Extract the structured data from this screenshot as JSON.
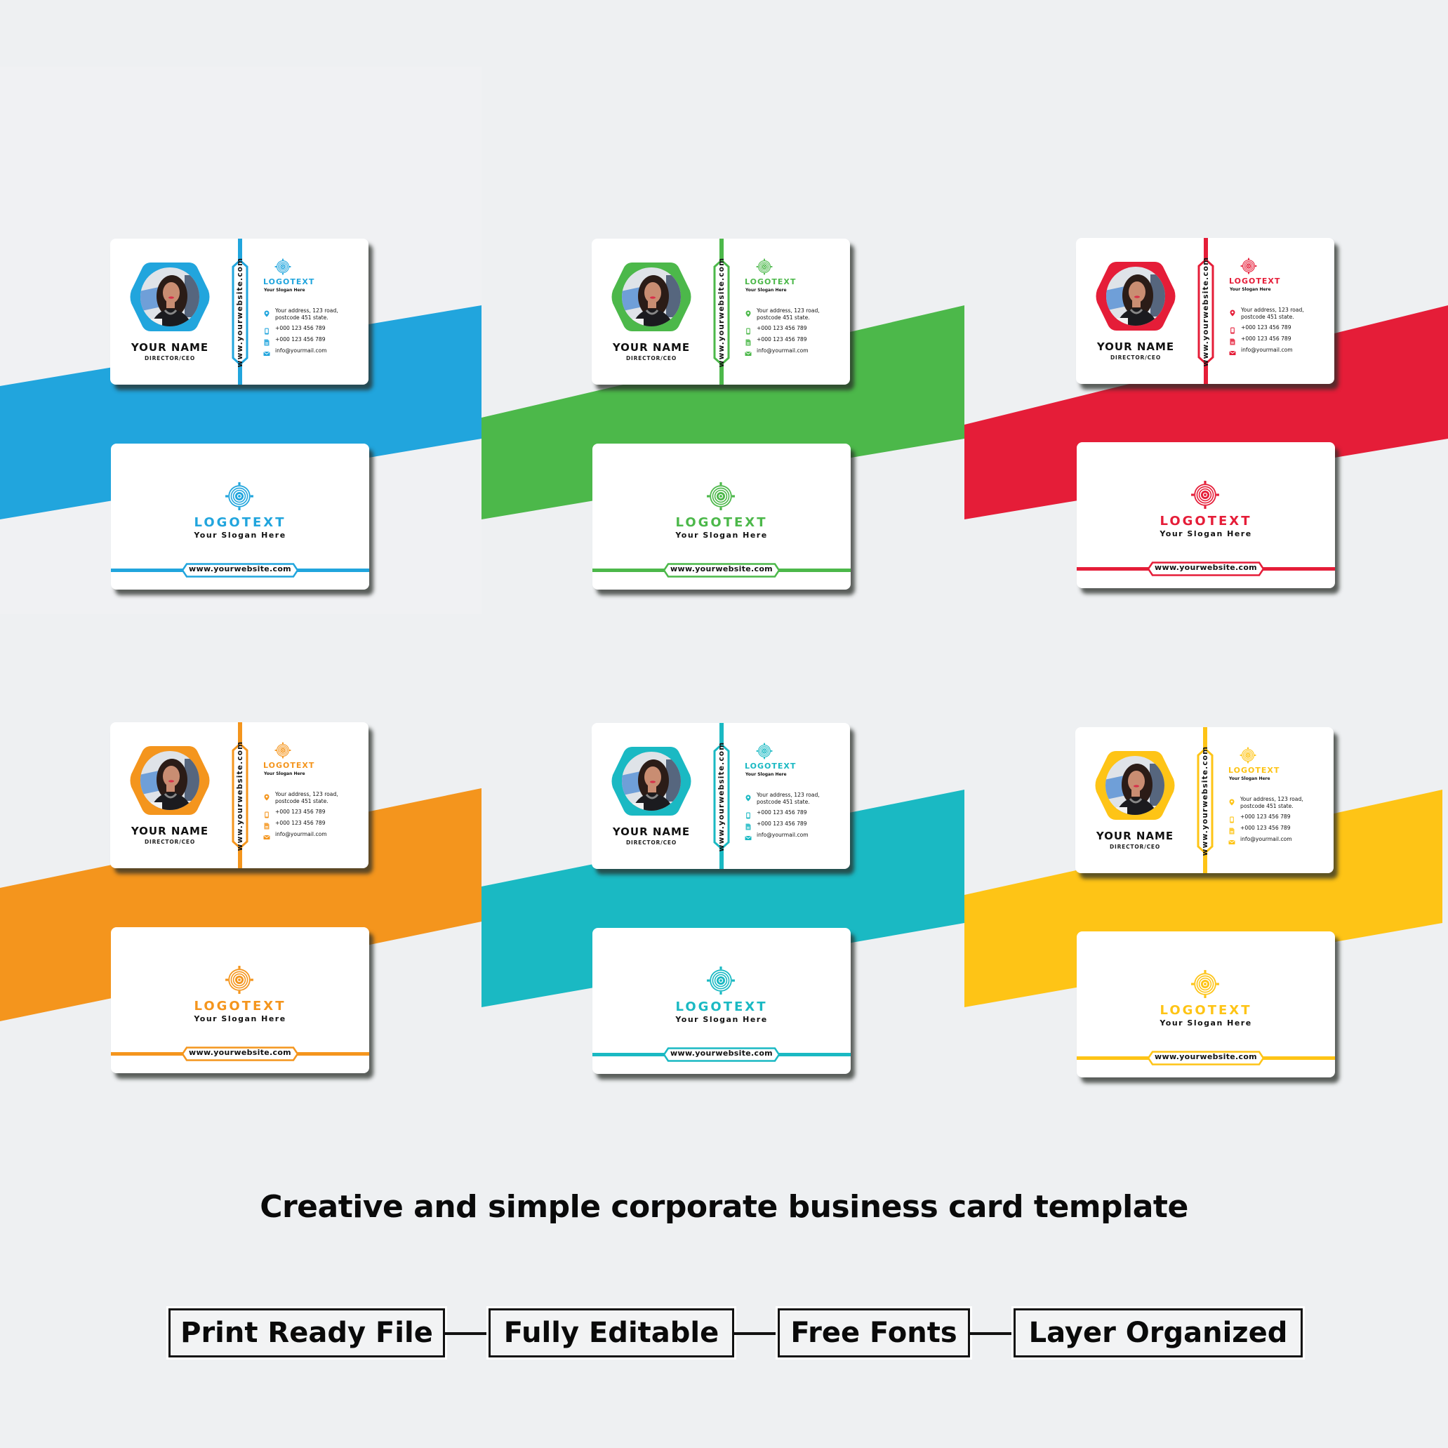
{
  "title": "Creative and simple corporate business card template",
  "features": [
    {
      "label": "Print Ready File"
    },
    {
      "label": "Fully Editable"
    },
    {
      "label": "Free Fonts"
    },
    {
      "label": "Layer Organized"
    }
  ],
  "card_text": {
    "name": "YOUR NAME",
    "role": "DIRECTOR/CEO",
    "website_vertical": "www.yourwebsite.com",
    "logo_text": "LOGOTEXT",
    "slogan": "Your Slogan Here",
    "address": "Your address, 123 road, postcode 451 state.",
    "phone": "+000 123 456 789",
    "fax": "+000 123 456 789",
    "email": "info@yourmail.com",
    "website": "www.yourwebsite.com"
  },
  "variants": [
    {
      "name": "blue",
      "accent": "#21a5dd"
    },
    {
      "name": "green",
      "accent": "#4cb84a"
    },
    {
      "name": "red",
      "accent": "#e51d38"
    },
    {
      "name": "orange",
      "accent": "#f4951d"
    },
    {
      "name": "teal",
      "accent": "#1ab9c3"
    },
    {
      "name": "yellow",
      "accent": "#fec416"
    }
  ],
  "icons": {
    "address": "map-pin-icon",
    "phone": "mobile-phone-icon",
    "fax": "document-icon",
    "email": "envelope-icon",
    "logo": "target-logo-icon"
  }
}
